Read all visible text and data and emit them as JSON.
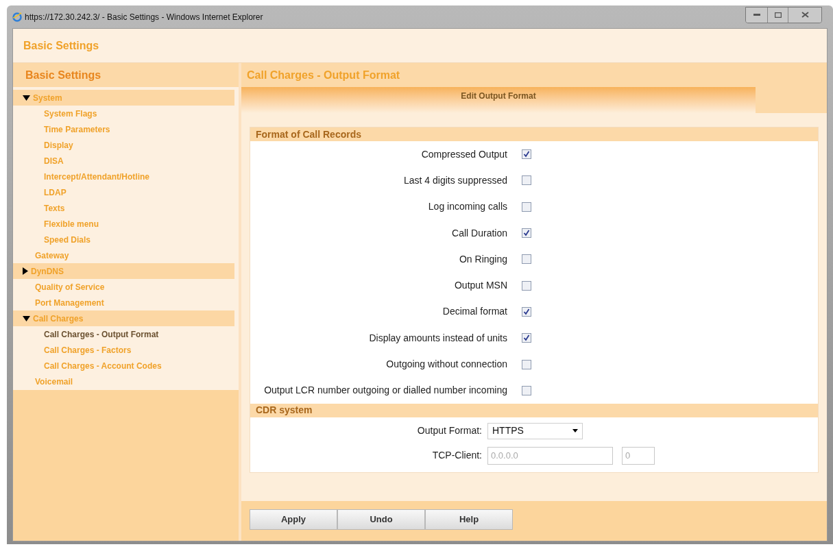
{
  "window": {
    "title": "https://172.30.242.3/ - Basic Settings - Windows Internet Explorer"
  },
  "header": {
    "title": "Basic Settings"
  },
  "sidebar": {
    "title": "Basic Settings",
    "items": [
      {
        "label": "System",
        "kind": "group",
        "expanded": true,
        "selected": false,
        "children": [
          {
            "label": "System Flags",
            "kind": "link",
            "selected": false
          },
          {
            "label": "Time Parameters",
            "kind": "link",
            "selected": false
          },
          {
            "label": "Display",
            "kind": "link",
            "selected": false
          },
          {
            "label": "DISA",
            "kind": "link",
            "selected": false
          },
          {
            "label": "Intercept/Attendant/Hotline",
            "kind": "link",
            "selected": false
          },
          {
            "label": "LDAP",
            "kind": "link",
            "selected": false
          },
          {
            "label": "Texts",
            "kind": "link",
            "selected": false
          },
          {
            "label": "Flexible menu",
            "kind": "link",
            "selected": false
          },
          {
            "label": "Speed Dials",
            "kind": "link",
            "selected": false
          }
        ]
      },
      {
        "label": "Gateway",
        "kind": "link",
        "selected": false
      },
      {
        "label": "DynDNS",
        "kind": "group",
        "expanded": false,
        "selected": false
      },
      {
        "label": "Quality of Service",
        "kind": "link",
        "selected": false
      },
      {
        "label": "Port Management",
        "kind": "link",
        "selected": false
      },
      {
        "label": "Call Charges",
        "kind": "group",
        "expanded": true,
        "selected": false,
        "children": [
          {
            "label": "Call Charges - Output Format",
            "kind": "link",
            "selected": true
          },
          {
            "label": "Call Charges - Factors",
            "kind": "link",
            "selected": false
          },
          {
            "label": "Call Charges - Account Codes",
            "kind": "link",
            "selected": false
          }
        ]
      },
      {
        "label": "Voicemail",
        "kind": "link",
        "selected": false
      }
    ]
  },
  "content": {
    "title": "Call Charges - Output Format",
    "tabs": [
      {
        "label": "Edit Output Format",
        "selected": true
      }
    ],
    "sections": [
      {
        "title": "Format of Call Records",
        "rows": [
          {
            "kind": "checkbox",
            "label": "Compressed Output",
            "checked": true
          },
          {
            "kind": "checkbox",
            "label": "Last 4 digits suppressed",
            "checked": false
          },
          {
            "kind": "checkbox",
            "label": "Log incoming calls",
            "checked": false
          },
          {
            "kind": "checkbox",
            "label": "Call Duration",
            "checked": true
          },
          {
            "kind": "checkbox",
            "label": "On Ringing",
            "checked": false
          },
          {
            "kind": "checkbox",
            "label": "Output MSN",
            "checked": false
          },
          {
            "kind": "checkbox",
            "label": "Decimal format",
            "checked": true
          },
          {
            "kind": "checkbox",
            "label": "Display amounts instead of units",
            "checked": true
          },
          {
            "kind": "checkbox",
            "label": "Outgoing without connection",
            "checked": false
          },
          {
            "kind": "checkbox",
            "label": "Output LCR number outgoing or dialled number incoming",
            "checked": false
          }
        ]
      },
      {
        "title": "CDR system",
        "rows": [
          {
            "kind": "select",
            "label": "Output Format:",
            "value": "HTTPS"
          },
          {
            "kind": "inputs",
            "label": "TCP-Client:",
            "fields": [
              {
                "value": "0.0.0.0",
                "disabled": true
              },
              {
                "value": "0",
                "disabled": true
              }
            ]
          }
        ]
      }
    ]
  },
  "buttons": [
    "Apply",
    "Undo",
    "Help"
  ]
}
